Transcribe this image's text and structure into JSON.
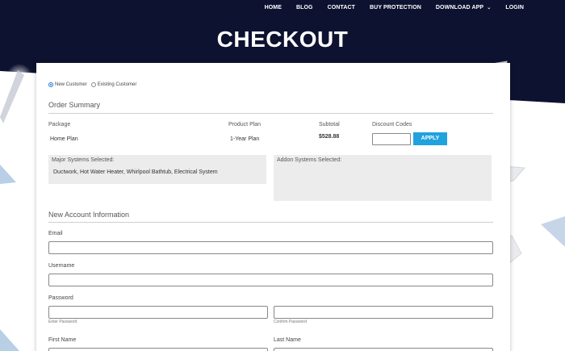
{
  "nav": {
    "items": [
      "HOME",
      "BLOG",
      "CONTACT",
      "BUY PROTECTION",
      "DOWNLOAD APP",
      "LOGIN"
    ],
    "dropdown_icon": "chevron-down-icon"
  },
  "page": {
    "title": "CHECKOUT"
  },
  "customer_type": {
    "options": [
      "New Customer",
      "Existing Customer"
    ],
    "selected": "New Customer"
  },
  "order_summary": {
    "title": "Order Summary",
    "headers": {
      "package": "Package",
      "plan": "Product Plan",
      "subtotal": "Subtotal",
      "discount": "Discount Codes"
    },
    "values": {
      "package": "Home Plan",
      "plan": "1-Year Plan",
      "subtotal": "$528.88"
    },
    "discount_input": {
      "value": "",
      "placeholder": ""
    },
    "apply_label": "APPLY",
    "major_systems": {
      "label": "Major Systems Selected:",
      "value": "Ductwork, Hot Water Heater, Whirlpool Bathtub, Electrical System"
    },
    "addon_systems": {
      "label": "Addon Systems Selected:",
      "value": ""
    }
  },
  "account": {
    "title": "New Account Information",
    "email_label": "Email",
    "username_label": "Username",
    "password_label": "Password",
    "password_hint": "Enter Password",
    "confirm_hint": "Confirm Password",
    "first_name_label": "First Name",
    "last_name_label": "Last Name"
  },
  "colors": {
    "hero_bg": "#0d1230",
    "accent": "#1fa2de",
    "radio_selected": "#1a73e8"
  }
}
